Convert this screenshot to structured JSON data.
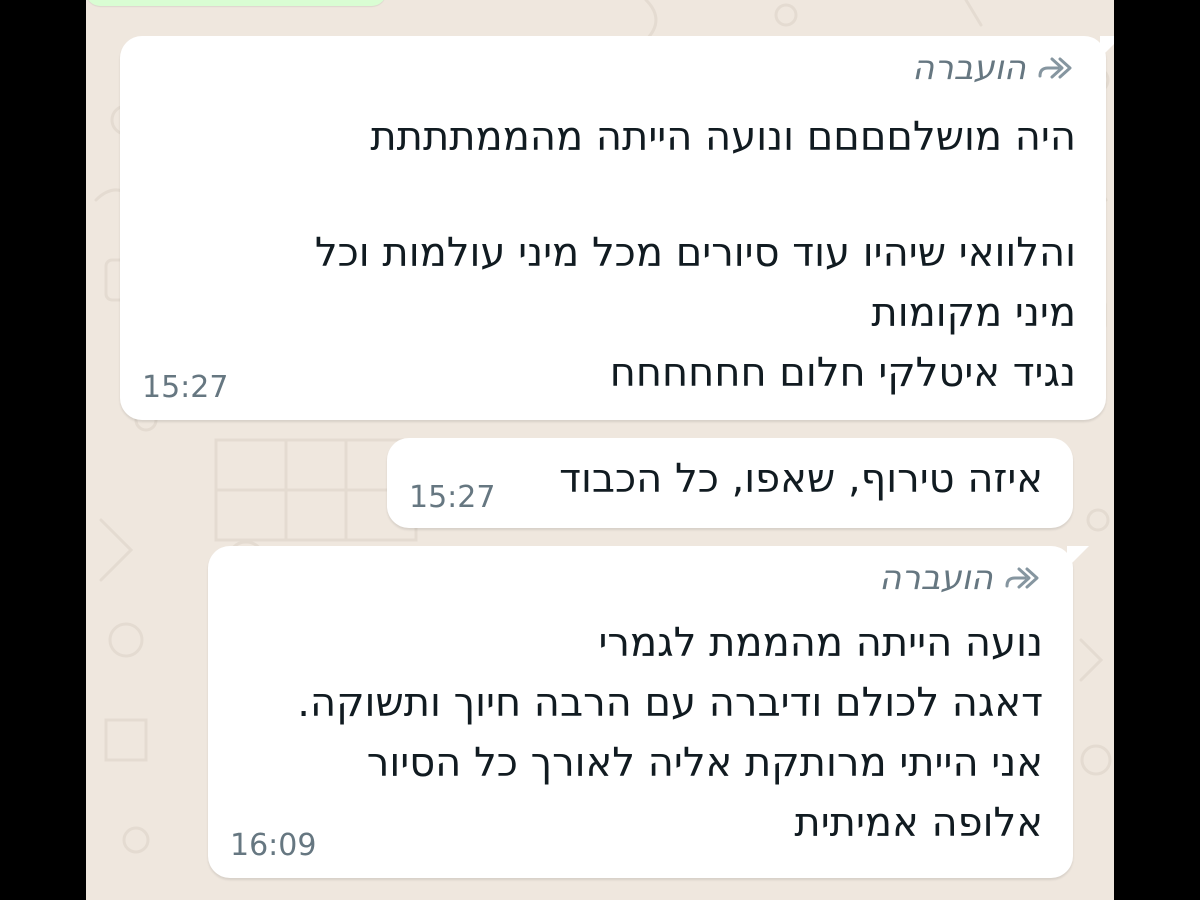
{
  "colors": {
    "wallpaper": "#efe7de",
    "bubble_incoming": "#ffffff",
    "text_primary": "#111b21",
    "text_meta": "#667781"
  },
  "messages": [
    {
      "forwarded_label": "הועברה",
      "forwarded_icon": "forwarded-arrow-icon",
      "lines": [
        "היה מושלםםםם ונועה הייתה מהממתתתת",
        "",
        "והלוואי שיהיו עוד סיורים מכל מיני עולמות וכל",
        "מיני מקומות",
        "נגיד איטלקי חלום חחחחחח"
      ],
      "time": "15:27"
    },
    {
      "lines": [
        "איזה טירוף, שאפו, כל הכבוד"
      ],
      "time": "15:27"
    },
    {
      "forwarded_label": "הועברה",
      "forwarded_icon": "forwarded-arrow-icon",
      "lines": [
        "נועה הייתה מהממת לגמרי",
        "דאגה לכולם ודיברה עם הרבה חיוך ותשוקה.",
        "אני הייתי מרותקת אליה לאורך כל הסיור",
        "אלופה אמיתית"
      ],
      "time": "16:09"
    }
  ]
}
